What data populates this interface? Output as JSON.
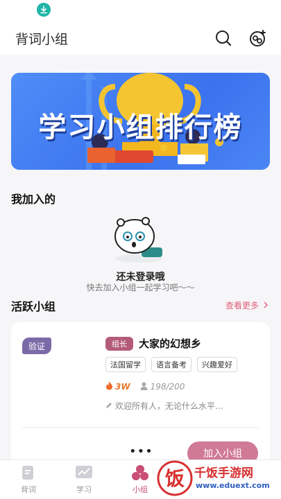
{
  "header": {
    "title": "背词小组"
  },
  "banner": {
    "title": "学习小组排行榜"
  },
  "joined": {
    "title": "我加入的",
    "empty_main": "还未登录哦",
    "empty_sub": "快去加入小组一起学习吧～～"
  },
  "active": {
    "title": "活跃小组",
    "more_label": "查看更多"
  },
  "group": {
    "verify_label": "验证",
    "leader_label": "组长",
    "name": "大家的幻想乡",
    "tags": [
      "法国留学",
      "语言备考",
      "兴趣爱好"
    ],
    "hot": "3W",
    "members": "198/200",
    "motto": "欢迎所有人，无论什么水平...",
    "join_label": "加入小组",
    "more_dots": "•••"
  },
  "tabs": [
    {
      "label": "背词",
      "icon": "book-icon"
    },
    {
      "label": "学习",
      "icon": "chart-icon"
    },
    {
      "label": "小组",
      "icon": "group-icon",
      "active": true
    },
    {
      "label": "",
      "icon": ""
    },
    {
      "label": "",
      "icon": ""
    }
  ],
  "watermark": {
    "brand": "千饭手游网",
    "url": "www.eduext.com",
    "logo_char": "饭"
  },
  "colors": {
    "accent": "#c94f75",
    "join_button": "#d07a96",
    "banner_blue": "#3b72ee",
    "verify": "#7b6aa8"
  }
}
